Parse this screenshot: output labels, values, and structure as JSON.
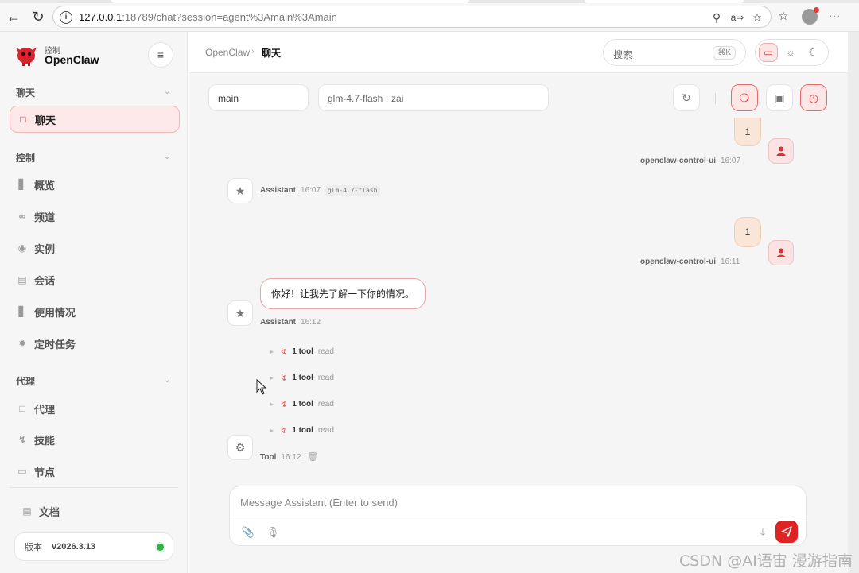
{
  "browser": {
    "url_host": "127.0.0.1",
    "url_rest": ":18789/chat?session=agent%3Amain%3Amain"
  },
  "sidebar": {
    "brand_small": "控制",
    "brand": "OpenClaw",
    "groups": [
      {
        "title": "聊天",
        "items": [
          {
            "label": "聊天",
            "icon": "chat-icon",
            "active": true
          }
        ]
      },
      {
        "title": "控制",
        "items": [
          {
            "label": "概览",
            "icon": "bar-chart-icon"
          },
          {
            "label": "频道",
            "icon": "link-icon"
          },
          {
            "label": "实例",
            "icon": "broadcast-icon"
          },
          {
            "label": "会话",
            "icon": "document-icon"
          },
          {
            "label": "使用情况",
            "icon": "bar-chart-icon"
          },
          {
            "label": "定时任务",
            "icon": "loader-icon"
          }
        ]
      },
      {
        "title": "代理",
        "items": [
          {
            "label": "代理",
            "icon": "folder-icon"
          },
          {
            "label": "技能",
            "icon": "bolt-icon"
          },
          {
            "label": "节点",
            "icon": "monitor-icon"
          }
        ]
      }
    ],
    "docs_label": "文档",
    "version_label": "版本",
    "version_value": "v2026.3.13",
    "status_color": "#2fb344"
  },
  "header": {
    "breadcrumb_root": "OpenClaw",
    "breadcrumb_current": "聊天",
    "search_placeholder": "搜索",
    "search_shortcut": "⌘K",
    "theme_selected": "system"
  },
  "session": {
    "session_key": "main",
    "model": "glm-4.7-flash · zai"
  },
  "messages": {
    "user1": {
      "text": "1",
      "sender": "openclaw-control-ui",
      "time": "16:07"
    },
    "bot1": {
      "sender": "Assistant",
      "time": "16:07",
      "model_tag": "glm-4.7-flash"
    },
    "user2": {
      "text": "1",
      "sender": "openclaw-control-ui",
      "time": "16:11"
    },
    "bot2": {
      "text": "你好！让我先了解一下你的情况。",
      "sender": "Assistant",
      "time": "16:12"
    },
    "tools": [
      {
        "count": "1 tool",
        "name": "read"
      },
      {
        "count": "1 tool",
        "name": "read"
      },
      {
        "count": "1 tool",
        "name": "read"
      },
      {
        "count": "1 tool",
        "name": "read"
      }
    ],
    "tool_group": {
      "sender": "Tool",
      "time": "16:12"
    }
  },
  "composer": {
    "placeholder": "Message Assistant (Enter to send)"
  },
  "accent_color": "#e02424",
  "watermark": "CSDN @AI语宙 漫游指南"
}
